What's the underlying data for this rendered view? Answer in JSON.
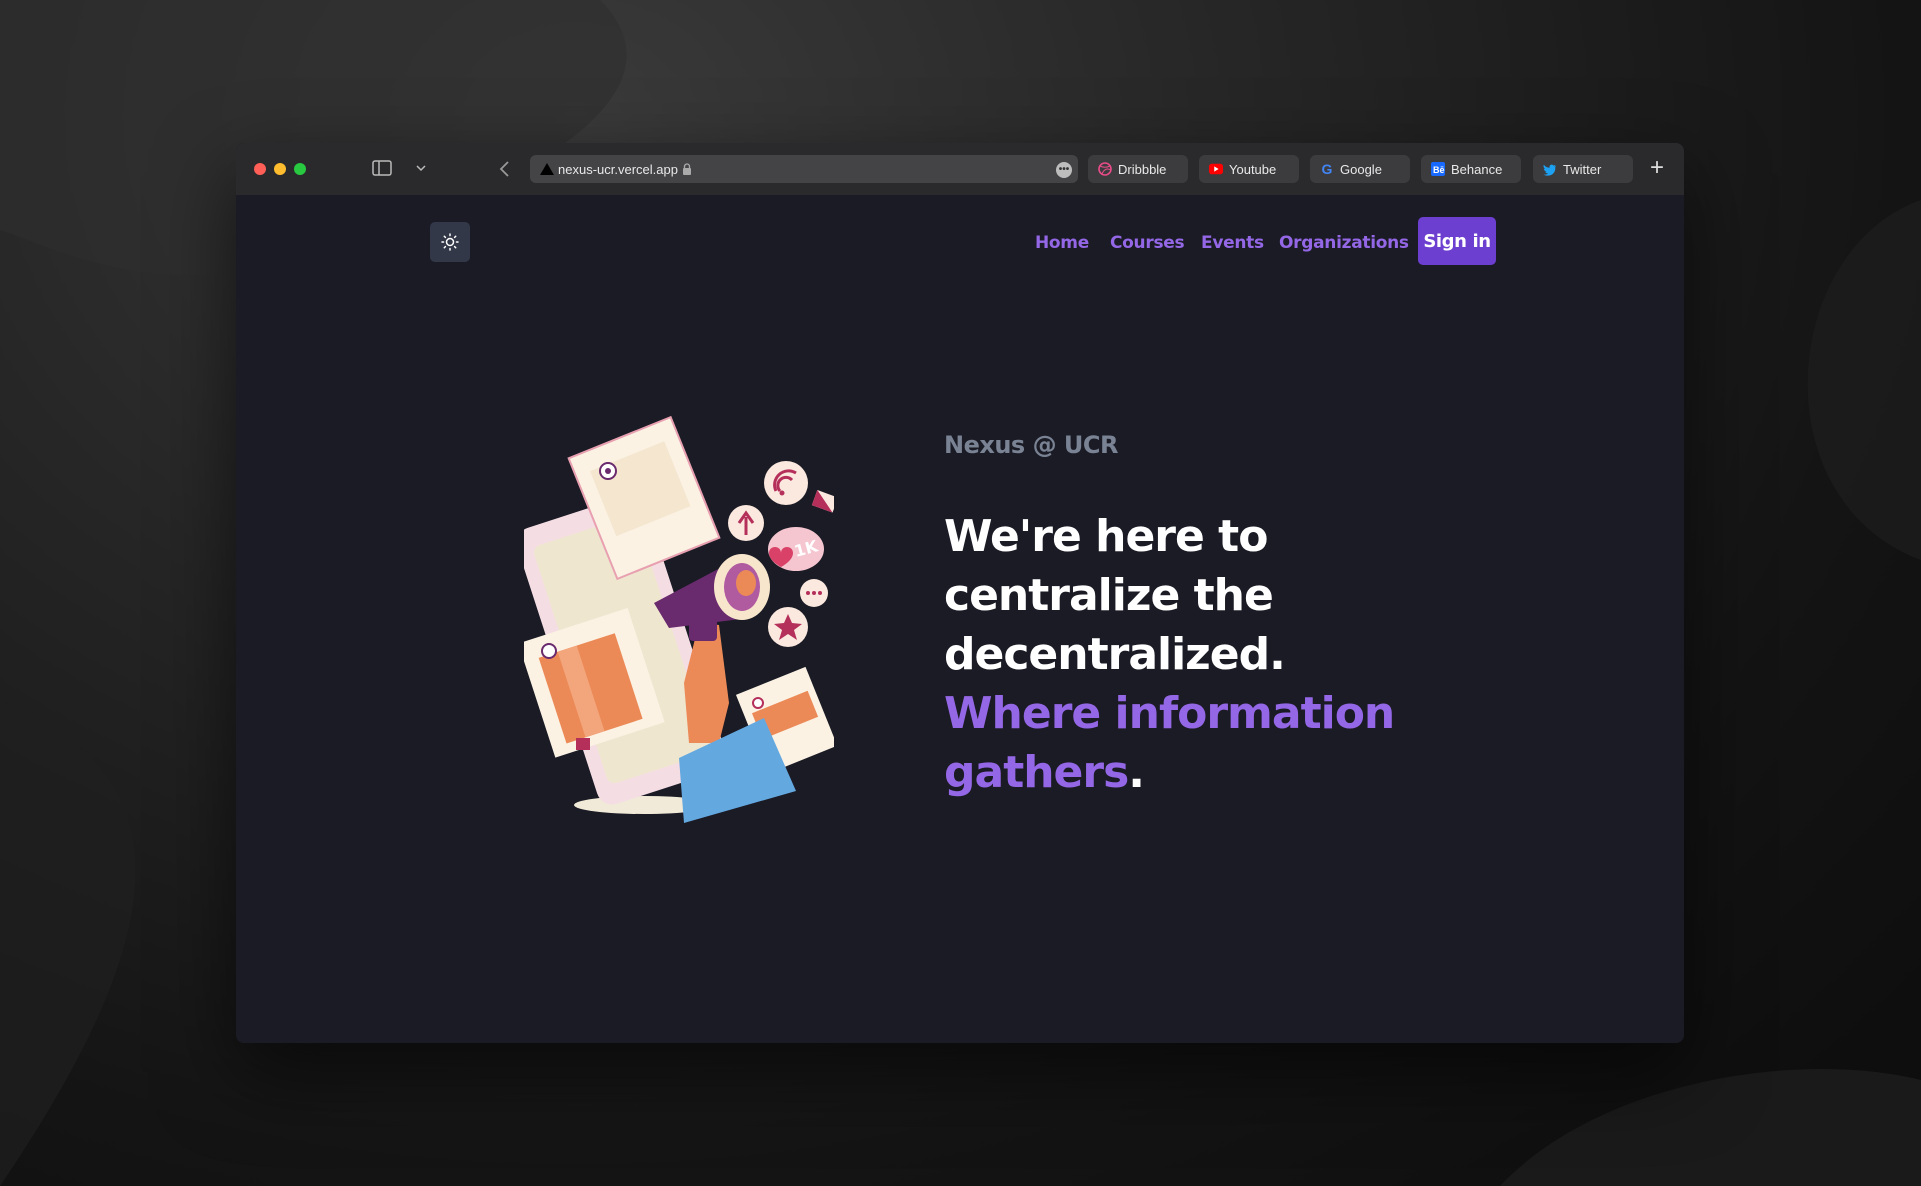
{
  "browser": {
    "url": "nexus-ucr.vercel.app",
    "tabs": [
      {
        "label": "Dribbble",
        "icon": "dribbble-icon"
      },
      {
        "label": "Youtube",
        "icon": "youtube-icon"
      },
      {
        "label": "Google",
        "icon": "google-icon"
      },
      {
        "label": "Behance",
        "icon": "behance-icon"
      },
      {
        "label": "Twitter",
        "icon": "twitter-icon"
      }
    ],
    "new_tab_label": "+"
  },
  "nav": {
    "items": [
      "Home",
      "Courses",
      "Events",
      "Organizations"
    ],
    "sign_in": "Sign in"
  },
  "hero": {
    "kicker": "Nexus @ UCR",
    "headline_line1": "We're here to",
    "headline_line2": "centralize the",
    "headline_line3": "decentralized.",
    "accent_line1": "Where information",
    "accent_line2": "gathers",
    "period": "."
  },
  "colors": {
    "accent": "#9467e6",
    "button": "#6d3fd0",
    "background": "#1a1b25"
  }
}
